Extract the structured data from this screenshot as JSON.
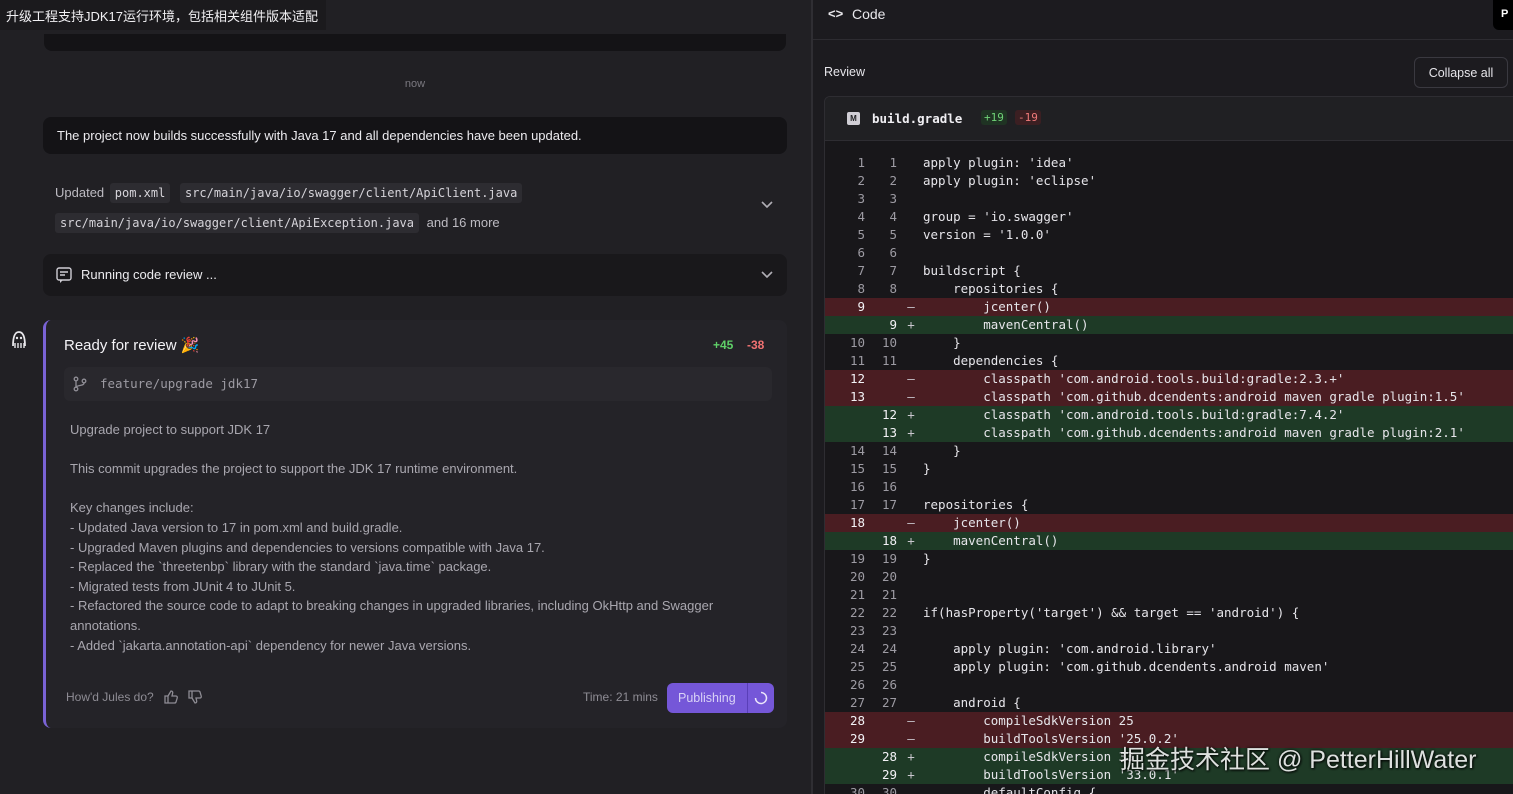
{
  "task_title": "升级工程支持JDK17运行环境，包括相关组件版本适配",
  "chat": {
    "timestamp": "now",
    "summary": "The project now builds successfully with Java 17 and all dependencies have been updated.",
    "updated": {
      "label": "Updated",
      "files": [
        "pom.xml",
        "src/main/java/io/swagger/client/ApiClient.java",
        "src/main/java/io/swagger/client/ApiException.java"
      ],
      "more": "and 16 more"
    },
    "code_review": {
      "label": "Running code review ..."
    }
  },
  "review_card": {
    "title": "Ready for review 🎉",
    "additions": "+45",
    "deletions": "-38",
    "branch": "feature/upgrade jdk17",
    "body": "Upgrade project to support JDK 17\n\nThis commit upgrades the project to support the JDK 17 runtime environment.\n\nKey changes include:\n- Updated Java version to 17 in pom.xml and build.gradle.\n- Upgraded Maven plugins and dependencies to versions compatible with Java 17.\n- Replaced the `threetenbp` library with the standard `java.time` package.\n- Migrated tests from JUnit 4 to JUnit 5.\n- Refactored the source code to adapt to breaking changes in upgraded libraries, including OkHttp and Swagger annotations.\n- Added `jakarta.annotation-api` dependency for newer Java versions.",
    "feedback_prompt": "How'd Jules do?",
    "time": "Time: 21 mins",
    "publish_label": "Publishing"
  },
  "code_panel": {
    "title": "Code",
    "badge": "P",
    "review_label": "Review",
    "collapse_label": "Collapse all",
    "file": {
      "name": "build.gradle",
      "additions": "+19",
      "deletions": "-19"
    }
  },
  "diff_lines": [
    {
      "o": "1",
      "n": "1",
      "t": "ctx",
      "c": "apply plugin: 'idea'"
    },
    {
      "o": "2",
      "n": "2",
      "t": "ctx",
      "c": "apply plugin: 'eclipse'"
    },
    {
      "o": "3",
      "n": "3",
      "t": "ctx",
      "c": ""
    },
    {
      "o": "4",
      "n": "4",
      "t": "ctx",
      "c": "group = 'io.swagger'"
    },
    {
      "o": "5",
      "n": "5",
      "t": "ctx",
      "c": "version = '1.0.0'"
    },
    {
      "o": "6",
      "n": "6",
      "t": "ctx",
      "c": ""
    },
    {
      "o": "7",
      "n": "7",
      "t": "ctx",
      "c": "buildscript {"
    },
    {
      "o": "8",
      "n": "8",
      "t": "ctx",
      "c": "    repositories {"
    },
    {
      "o": "9",
      "n": "",
      "t": "del",
      "c": "        jcenter()"
    },
    {
      "o": "",
      "n": "9",
      "t": "add",
      "c": "        mavenCentral()"
    },
    {
      "o": "10",
      "n": "10",
      "t": "ctx",
      "c": "    }"
    },
    {
      "o": "11",
      "n": "11",
      "t": "ctx",
      "c": "    dependencies {"
    },
    {
      "o": "12",
      "n": "",
      "t": "del",
      "c": "        classpath 'com.android.tools.build:gradle:2.3.+'"
    },
    {
      "o": "13",
      "n": "",
      "t": "del",
      "c": "        classpath 'com.github.dcendents:android maven gradle plugin:1.5'"
    },
    {
      "o": "",
      "n": "12",
      "t": "add",
      "c": "        classpath 'com.android.tools.build:gradle:7.4.2'"
    },
    {
      "o": "",
      "n": "13",
      "t": "add",
      "c": "        classpath 'com.github.dcendents:android maven gradle plugin:2.1'"
    },
    {
      "o": "14",
      "n": "14",
      "t": "ctx",
      "c": "    }"
    },
    {
      "o": "15",
      "n": "15",
      "t": "ctx",
      "c": "}"
    },
    {
      "o": "16",
      "n": "16",
      "t": "ctx",
      "c": ""
    },
    {
      "o": "17",
      "n": "17",
      "t": "ctx",
      "c": "repositories {"
    },
    {
      "o": "18",
      "n": "",
      "t": "del",
      "c": "    jcenter()"
    },
    {
      "o": "",
      "n": "18",
      "t": "add",
      "c": "    mavenCentral()"
    },
    {
      "o": "19",
      "n": "19",
      "t": "ctx",
      "c": "}"
    },
    {
      "o": "20",
      "n": "20",
      "t": "ctx",
      "c": ""
    },
    {
      "o": "21",
      "n": "21",
      "t": "ctx",
      "c": ""
    },
    {
      "o": "22",
      "n": "22",
      "t": "ctx",
      "c": "if(hasProperty('target') && target == 'android') {"
    },
    {
      "o": "23",
      "n": "23",
      "t": "ctx",
      "c": ""
    },
    {
      "o": "24",
      "n": "24",
      "t": "ctx",
      "c": "    apply plugin: 'com.android.library'"
    },
    {
      "o": "25",
      "n": "25",
      "t": "ctx",
      "c": "    apply plugin: 'com.github.dcendents.android maven'"
    },
    {
      "o": "26",
      "n": "26",
      "t": "ctx",
      "c": ""
    },
    {
      "o": "27",
      "n": "27",
      "t": "ctx",
      "c": "    android {"
    },
    {
      "o": "28",
      "n": "",
      "t": "del",
      "c": "        compileSdkVersion 25"
    },
    {
      "o": "29",
      "n": "",
      "t": "del",
      "c": "        buildToolsVersion '25.0.2'"
    },
    {
      "o": "",
      "n": "28",
      "t": "add",
      "c": "        compileSdkVersion 33"
    },
    {
      "o": "",
      "n": "29",
      "t": "add",
      "c": "        buildToolsVersion '33.0.1'"
    },
    {
      "o": "30",
      "n": "30",
      "t": "ctx",
      "c": "        defaultConfig {"
    }
  ],
  "watermark": "掘金技术社区 @ PetterHillWater"
}
